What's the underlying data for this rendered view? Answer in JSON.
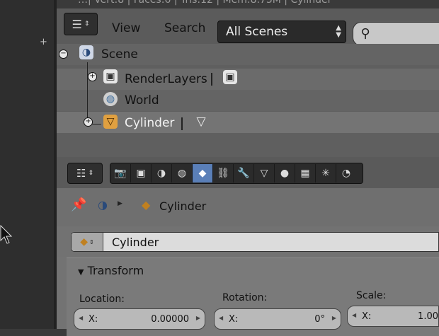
{
  "window": {
    "title": "…| Vert:8 | Faces:6 | Tris:12 | Mem:8.73M | Cylinder",
    "add_symbol": "+"
  },
  "outliner": {
    "menu": {
      "view": "View",
      "search": "Search"
    },
    "display_mode": "All Scenes",
    "tree": [
      {
        "label": "Scene",
        "icon": "scene-icon",
        "expander": "−"
      },
      {
        "label": "RenderLayers",
        "icon": "render-layers-icon",
        "expander": "+"
      },
      {
        "label": "World",
        "icon": "world-icon",
        "expander": ""
      },
      {
        "label": "Cylinder",
        "icon": "mesh-object-icon",
        "expander": "+",
        "selected": true
      }
    ]
  },
  "properties": {
    "tabs": [
      "render-icon",
      "render-layers-icon",
      "scene-icon",
      "world-icon",
      "object-icon",
      "constraints-icon",
      "modifiers-icon",
      "data-icon",
      "material-icon",
      "texture-icon",
      "particles-icon",
      "physics-icon"
    ],
    "active_tab": "object-icon",
    "breadcrumb": {
      "object": "Cylinder"
    },
    "object_name": "Cylinder",
    "panel": {
      "title": "Transform",
      "location_label": "Location:",
      "rotation_label": "Rotation:",
      "scale_label": "Scale:",
      "location_x": {
        "axis": "X:",
        "value": "0.00000"
      },
      "rotation_x": {
        "axis": "X:",
        "value": "0°"
      },
      "scale_x": {
        "axis": "X:",
        "value": "1.00"
      }
    }
  },
  "colors": {
    "accent": "#5a7fb8",
    "selected_text": "#f2f2f2",
    "header": "#5b5b5b"
  }
}
